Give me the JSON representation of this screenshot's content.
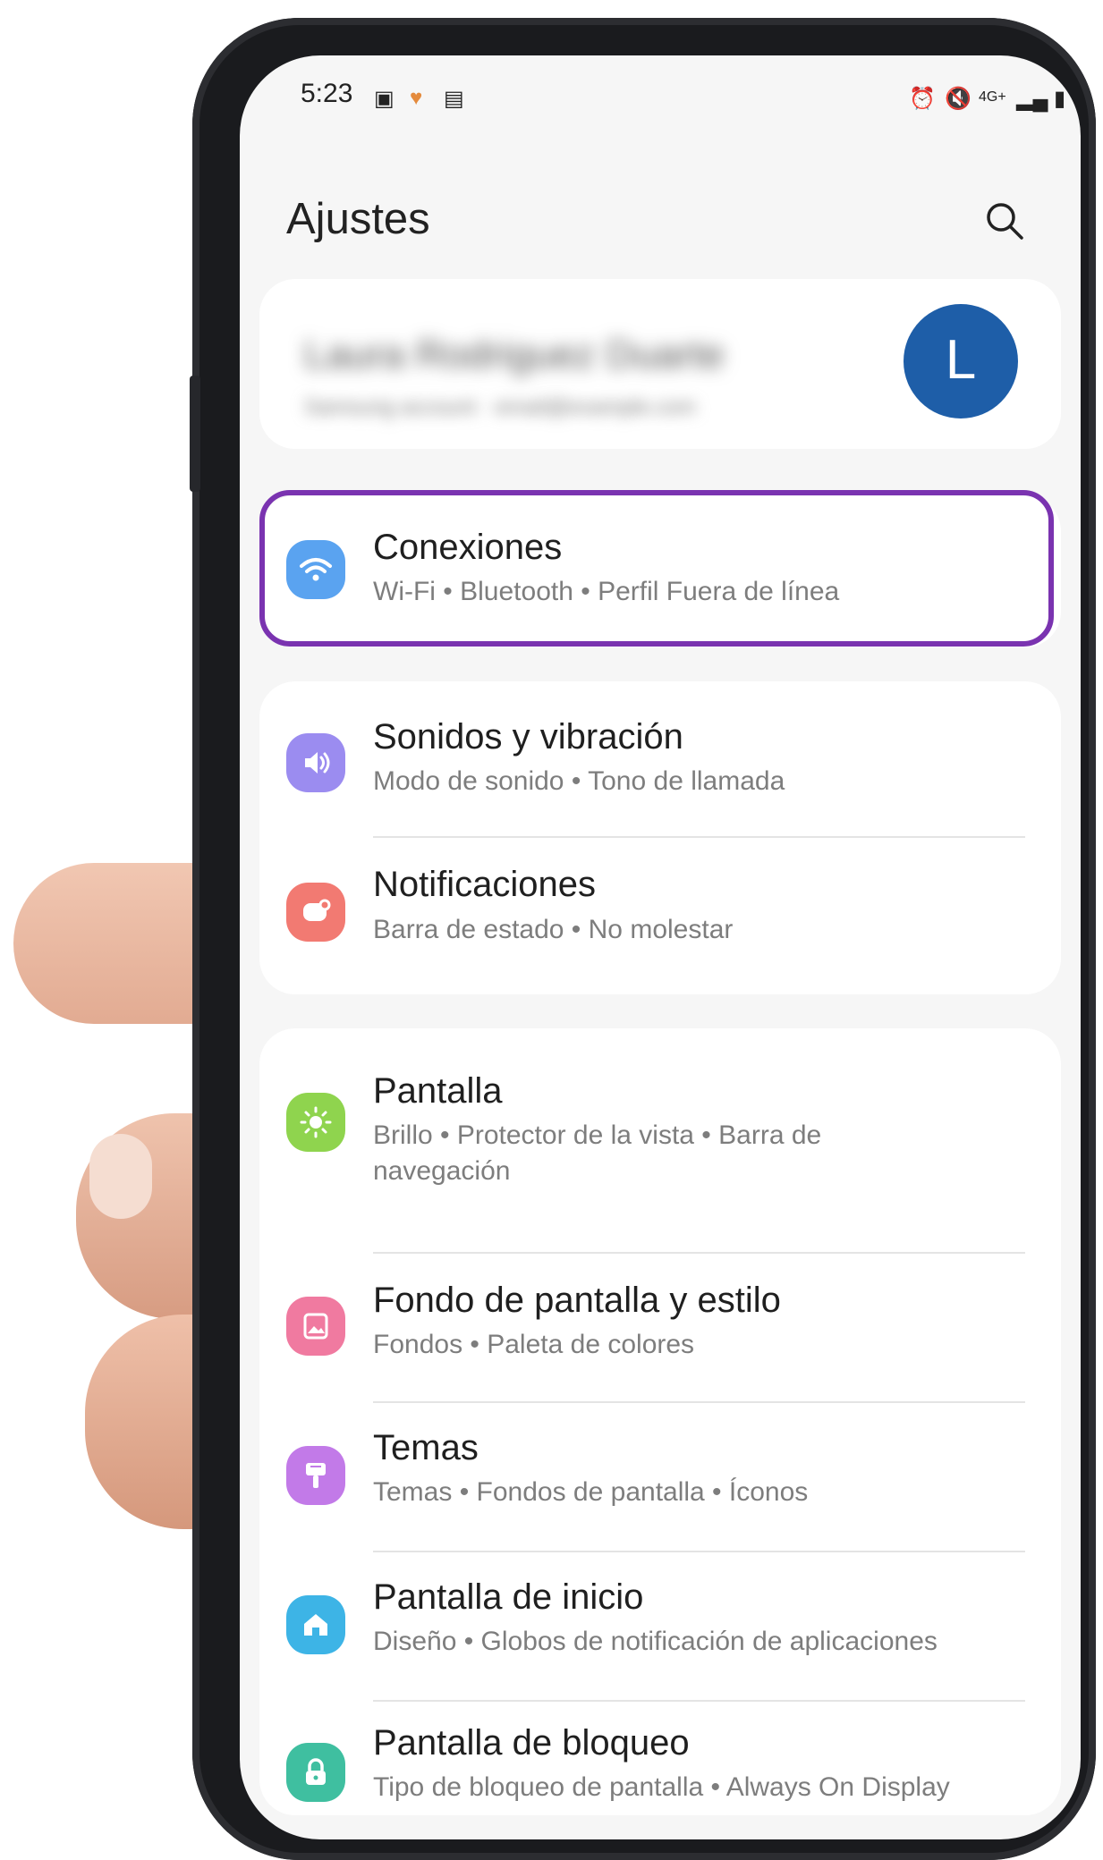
{
  "status": {
    "time": "5:23"
  },
  "header": {
    "title": "Ajustes"
  },
  "profile": {
    "name": "Laura Rodriguez Duarte",
    "subtitle": "Samsung account · email@example.com",
    "avatar_letter": "L"
  },
  "items": [
    {
      "title": "Conexiones",
      "subtitle": "Wi-Fi  •  Bluetooth  •  Perfil Fuera de línea",
      "icon": "wifi-icon",
      "color": "#5aa3f0"
    },
    {
      "title": "Sonidos y vibración",
      "subtitle": "Modo de sonido  •  Tono de llamada",
      "icon": "speaker-icon",
      "color": "#9b8cf0"
    },
    {
      "title": "Notificaciones",
      "subtitle": "Barra de estado  •  No molestar",
      "icon": "notification-icon",
      "color": "#f27a72"
    },
    {
      "title": "Pantalla",
      "subtitle": "Brillo  •  Protector de la vista  •  Barra de navegación",
      "icon": "brightness-icon",
      "color": "#8fd44e"
    },
    {
      "title": "Fondo de pantalla y estilo",
      "subtitle": "Fondos  •  Paleta de colores",
      "icon": "wallpaper-icon",
      "color": "#f07aa0"
    },
    {
      "title": "Temas",
      "subtitle": "Temas  •  Fondos de pantalla  •  Íconos",
      "icon": "brush-icon",
      "color": "#c27ae8"
    },
    {
      "title": "Pantalla de inicio",
      "subtitle": "Diseño  •  Globos de notificación de aplicaciones",
      "icon": "home-icon",
      "color": "#3db4e6"
    },
    {
      "title": "Pantalla de bloqueo",
      "subtitle": "Tipo de bloqueo de pantalla  •  Always On Display",
      "icon": "lock-icon",
      "color": "#3fbfa0"
    }
  ],
  "highlight_color": "#7a33b0"
}
